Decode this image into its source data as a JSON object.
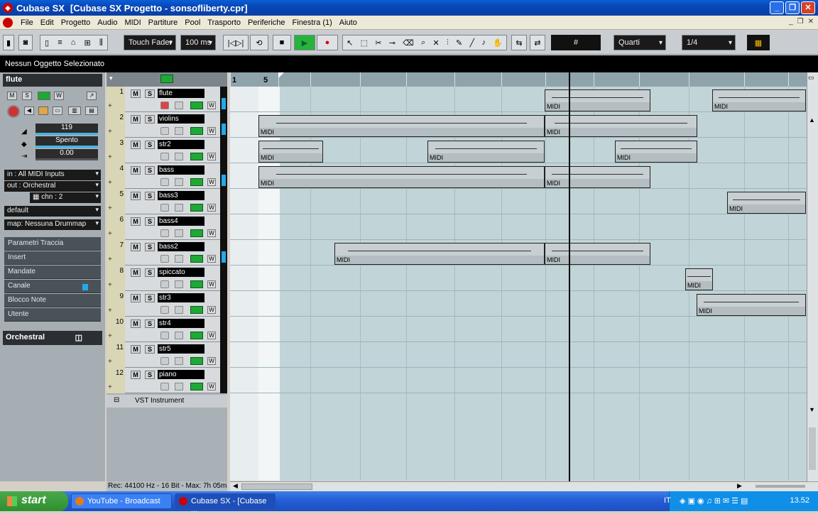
{
  "window": {
    "title": "Cubase SX",
    "doc_title": "[Cubase SX Progetto - sonsofliberty.cpr]"
  },
  "menu": [
    "File",
    "Edit",
    "Progetto",
    "Audio",
    "MIDI",
    "Partiture",
    "Pool",
    "Trasporto",
    "Periferiche",
    "Finestra (1)",
    "Aiuto"
  ],
  "toolbar": {
    "automation_mode": "Touch Fader",
    "preroll": "100 ms",
    "snap": "Quarti",
    "quantize": "1/4"
  },
  "infobar": {
    "text": "Nessun Oggetto Selezionato"
  },
  "inspector": {
    "track_name": "flute",
    "volume": "119",
    "pan": "Spento",
    "delay": "0.00",
    "input": "All MIDI Inputs",
    "in_label": "in :",
    "output": "Orchestral",
    "out_label": "out :",
    "channel_label": "chn :",
    "channel": "2",
    "program": "default",
    "map_label": "map:",
    "drummap": "Nessuna Drummap",
    "sections": [
      "Parametri Traccia",
      "Insert",
      "Mandate",
      "Canale",
      "Blocco Note",
      "Utente"
    ],
    "device": "Orchestral"
  },
  "tracks": [
    {
      "num": "1",
      "name": "flute"
    },
    {
      "num": "2",
      "name": "violins"
    },
    {
      "num": "3",
      "name": "str2"
    },
    {
      "num": "4",
      "name": "bass"
    },
    {
      "num": "5",
      "name": "bass3"
    },
    {
      "num": "6",
      "name": "bass4"
    },
    {
      "num": "7",
      "name": "bass2"
    },
    {
      "num": "8",
      "name": "spiccato"
    },
    {
      "num": "9",
      "name": "str3"
    },
    {
      "num": "10",
      "name": "str4"
    },
    {
      "num": "11",
      "name": "str5"
    },
    {
      "num": "12",
      "name": "piano"
    }
  ],
  "track_buttons": {
    "mute": "M",
    "solo": "S",
    "write": "W"
  },
  "vst_label": "VST Instrument",
  "ruler": {
    "labels": [
      "1",
      "5"
    ]
  },
  "part_label": "MIDI",
  "status": "Rec: 44100 Hz - 16 Bit - Max: 7h 05min",
  "taskbar": {
    "start": "start",
    "tasks": [
      "YouTube - Broadcast",
      "Cubase SX - [Cubase ..."
    ],
    "lang": "IT",
    "clock": "13.52"
  },
  "colors": {
    "track_green": "#1fa836",
    "meter_blue": "#24a9e6",
    "part_gray": "#b4bdc1",
    "arrange_bg": "#c1d4d7"
  }
}
